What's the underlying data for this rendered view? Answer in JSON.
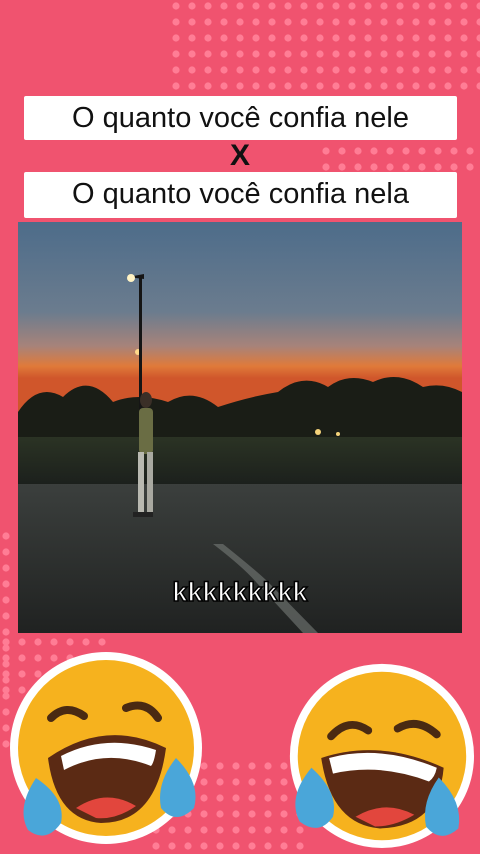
{
  "caption": {
    "line1": "O quanto você confia nele",
    "vs": "X",
    "line2": "O quanto você confia nela"
  },
  "video": {
    "subtitle": "kkkkkkkkk"
  },
  "colors": {
    "background": "#f0536f",
    "dots": "#ff7d95"
  },
  "emojis": [
    "face-with-tears-of-joy-icon",
    "face-with-tears-of-joy-icon"
  ]
}
